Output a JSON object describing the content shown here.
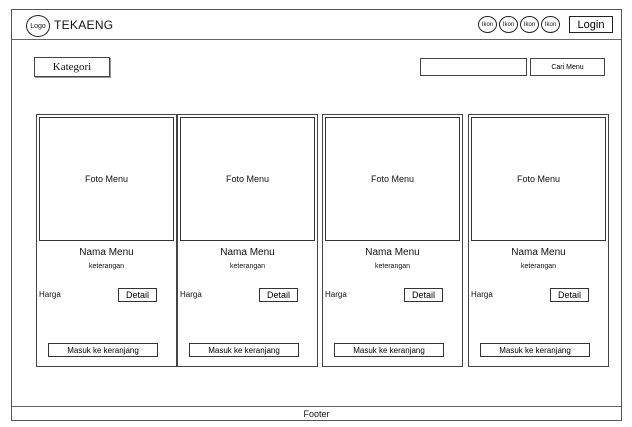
{
  "header": {
    "logo_label": "Logo",
    "brand": "TEKAENG",
    "icons": [
      "Ikon",
      "Ikon",
      "Ikon",
      "Ikon"
    ],
    "login_label": "Login"
  },
  "toolbar": {
    "kategori_label": "Kategori",
    "search_placeholder": "",
    "search_button_label": "Cari Menu"
  },
  "cards": [
    {
      "photo": "Foto Menu",
      "name": "Nama Menu",
      "desc": "keterangan",
      "price_label": "Harga",
      "detail_label": "Detail",
      "cart_label": "Masuk ke keranjang"
    },
    {
      "photo": "Foto Menu",
      "name": "Nama Menu",
      "desc": "keterangan",
      "price_label": "Harga",
      "detail_label": "Detail",
      "cart_label": "Masuk ke keranjang"
    },
    {
      "photo": "Foto Menu",
      "name": "Nama Menu",
      "desc": "keterangan",
      "price_label": "Harga",
      "detail_label": "Detail",
      "cart_label": "Masuk ke keranjang"
    },
    {
      "photo": "Foto Menu",
      "name": "Nama Menu",
      "desc": "keterangan",
      "price_label": "Harga",
      "detail_label": "Detail",
      "cart_label": "Masuk ke keranjang"
    }
  ],
  "footer": {
    "label": "Footer"
  }
}
